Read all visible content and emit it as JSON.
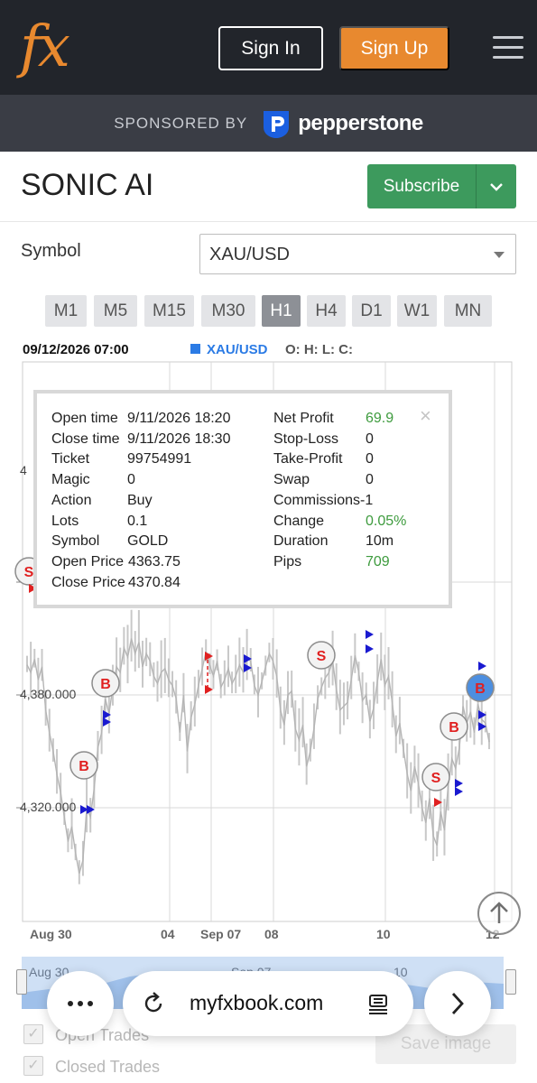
{
  "header": {
    "logo_text": "fx",
    "sign_in": "Sign In",
    "sign_up": "Sign Up",
    "colors": {
      "background": "#22252b",
      "accent": "#e8892f"
    }
  },
  "sponsor": {
    "label": "SPONSORED BY",
    "brand": "pepperstone",
    "brand_icon": "pepperstone-logo-icon"
  },
  "page": {
    "title": "SONIC AI",
    "subscribe_label": "Subscribe",
    "subscribe_color": "#3d9a5d"
  },
  "symbol": {
    "label": "Symbol",
    "selected": "XAU/USD"
  },
  "timeframes": {
    "items": [
      "M1",
      "M5",
      "M15",
      "M30",
      "H1",
      "H4",
      "D1",
      "W1",
      "MN"
    ],
    "active": "H1"
  },
  "chart": {
    "datetime": "09/12/2026 07:00",
    "symbol": "XAU/USD",
    "ohlc_label": "O: H: L: C:",
    "y_labels": [
      "4,380.000",
      "4,320.000",
      "4"
    ],
    "x_labels": [
      "Aug 30",
      "04",
      "Sep 07",
      "08",
      "10",
      "12"
    ],
    "navigator_labels": [
      "Aug 30",
      "Sep 07",
      "10"
    ],
    "colors": {
      "price": "#c8c8c8",
      "buy_marker": "#1a1ad0",
      "sell_marker": "#e02020",
      "badge_text": "#e02020"
    }
  },
  "chart_data": {
    "type": "line",
    "y": [
      4396,
      4392,
      4399,
      4388,
      4395,
      4372,
      4360,
      4350,
      4338,
      4328,
      4315,
      4302,
      4310,
      4296,
      4285,
      4292,
      4320,
      4315,
      4330,
      4352,
      4360,
      4378,
      4370,
      4384,
      4395,
      4392,
      4405,
      4400,
      4410,
      4402,
      4408,
      4395,
      4402,
      4398,
      4390,
      4386,
      4392,
      4394,
      4388,
      4385,
      4378,
      4360,
      4380,
      4350,
      4368,
      4375,
      4385,
      4394,
      4403,
      4396,
      4390,
      4398,
      4384,
      4388,
      4394,
      4386,
      4390,
      4396,
      4392,
      4400,
      4398,
      4385,
      4380,
      4387,
      4395,
      4402,
      4398,
      4390,
      4372,
      4364,
      4380,
      4382,
      4362,
      4356,
      4364,
      4342,
      4350,
      4362,
      4378,
      4384,
      4389,
      4392,
      4398,
      4383,
      4372,
      4374,
      4376,
      4388,
      4401,
      4392,
      4377,
      4380,
      4366,
      4373,
      4387,
      4399,
      4385,
      4390,
      4376,
      4358,
      4365,
      4351,
      4338,
      4329,
      4342,
      4333,
      4320,
      4312,
      4325,
      4305,
      4300,
      4318,
      4308,
      4332,
      4346,
      4341,
      4352,
      4374,
      4365,
      4371,
      4360,
      4375,
      4367,
      4365,
      4355
    ],
    "markers": [
      {
        "label": "S",
        "kind": "sell"
      },
      {
        "label": "B",
        "kind": "buy"
      },
      {
        "label": "B",
        "kind": "buy"
      },
      {
        "label": "S",
        "kind": "sell"
      },
      {
        "label": "S",
        "kind": "sell"
      },
      {
        "label": "B",
        "kind": "buy"
      },
      {
        "label": "B",
        "kind": "buy",
        "highlighted": true
      }
    ]
  },
  "tooltip": {
    "left": [
      {
        "k": "Open time",
        "v": "9/11/2026 18:20"
      },
      {
        "k": "Close time",
        "v": "9/11/2026 18:30"
      },
      {
        "k": "Ticket",
        "v": "99754991"
      },
      {
        "k": "Magic",
        "v": "0"
      },
      {
        "k": "Action",
        "v": "Buy"
      },
      {
        "k": "Lots",
        "v": "0.1"
      },
      {
        "k": "Symbol",
        "v": "GOLD"
      },
      {
        "k": "Open Price",
        "v": "4363.75"
      },
      {
        "k": "Close Price",
        "v": "4370.84"
      }
    ],
    "right": [
      {
        "k": "Net Profit",
        "v": "69.9",
        "green": true
      },
      {
        "k": "Stop-Loss",
        "v": "0"
      },
      {
        "k": "Take-Profit",
        "v": "0"
      },
      {
        "k": "Swap",
        "v": "0"
      },
      {
        "k": "Commissions",
        "v": "-1"
      },
      {
        "k": "Change",
        "v": "0.05%",
        "green": true
      },
      {
        "k": "Duration",
        "v": "10m"
      },
      {
        "k": "Pips",
        "v": "709",
        "green": true
      }
    ],
    "close_glyph": "×"
  },
  "options": {
    "open_trades": "Open Trades",
    "closed_trades": "Closed Trades",
    "save_image": "Save image",
    "check_glyph": "✓"
  },
  "browser": {
    "url": "myfxbook.com",
    "more_icon": "more-dots-icon",
    "reload_icon": "reload-icon",
    "reader_icon": "reader-icon",
    "forward_icon": "chevron-right-icon"
  }
}
